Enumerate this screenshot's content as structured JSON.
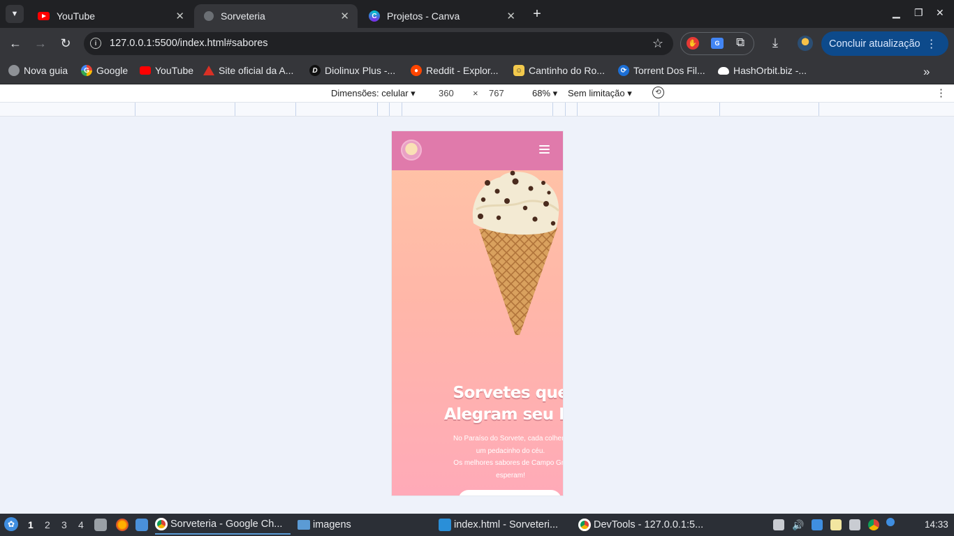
{
  "browser": {
    "tabs": [
      {
        "title": "YouTube",
        "favicon": "youtube-icon",
        "active": false
      },
      {
        "title": "Sorveteria",
        "favicon": "globe-icon",
        "active": true
      },
      {
        "title": "Projetos - Canva",
        "favicon": "canva-icon",
        "active": false
      }
    ],
    "close_glyph": "✕",
    "url": "127.0.0.1:5500/index.html#sabores",
    "update_button_label": "Concluir atualização",
    "bookmarks": [
      {
        "label": "Nova guia",
        "icon": "globe-icon"
      },
      {
        "label": "Google",
        "icon": "google-icon"
      },
      {
        "label": "YouTube",
        "icon": "youtube-icon"
      },
      {
        "label": "Site oficial da A...",
        "icon": "warning-icon"
      },
      {
        "label": "Diolinux Plus -...",
        "icon": "diolinux-icon"
      },
      {
        "label": "Reddit - Explor...",
        "icon": "reddit-icon"
      },
      {
        "label": "Cantinho do Ro...",
        "icon": "cantinho-icon"
      },
      {
        "label": "Torrent Dos Fil...",
        "icon": "torrent-icon"
      },
      {
        "label": "HashOrbit.biz -...",
        "icon": "cloud-icon"
      }
    ]
  },
  "devtools": {
    "dimensions_label": "Dimensões: celular",
    "width": "360",
    "times": "×",
    "height": "767",
    "zoom": "68%",
    "throttling": "Sem limitação"
  },
  "site": {
    "hero": {
      "title_line1": "Sorvetes que",
      "title_line2": "Alegram seu Di",
      "text_line1": "No Paraíso do Sorvete, cada colhera",
      "text_line2": "um pedacinho do céu.",
      "text_line3": "Os melhores sabores de Campo Gra",
      "text_line4": "esperam!"
    },
    "colors": {
      "header": "#e07aab",
      "gradient_top": "#ffc5a6",
      "gradient_bottom": "#ffaab8"
    }
  },
  "taskbar": {
    "workspaces": [
      "1",
      "2",
      "3",
      "4"
    ],
    "windows": [
      {
        "label": "Sorveteria - Google Ch...",
        "icon": "chrome-icon",
        "active": true
      },
      {
        "label": "imagens",
        "icon": "folder-icon",
        "active": false
      },
      {
        "label": "index.html - Sorveteri...",
        "icon": "vscode-icon",
        "active": false
      },
      {
        "label": "DevTools - 127.0.0.1:5...",
        "icon": "chrome-icon",
        "active": false
      }
    ],
    "clock": "14:33"
  }
}
